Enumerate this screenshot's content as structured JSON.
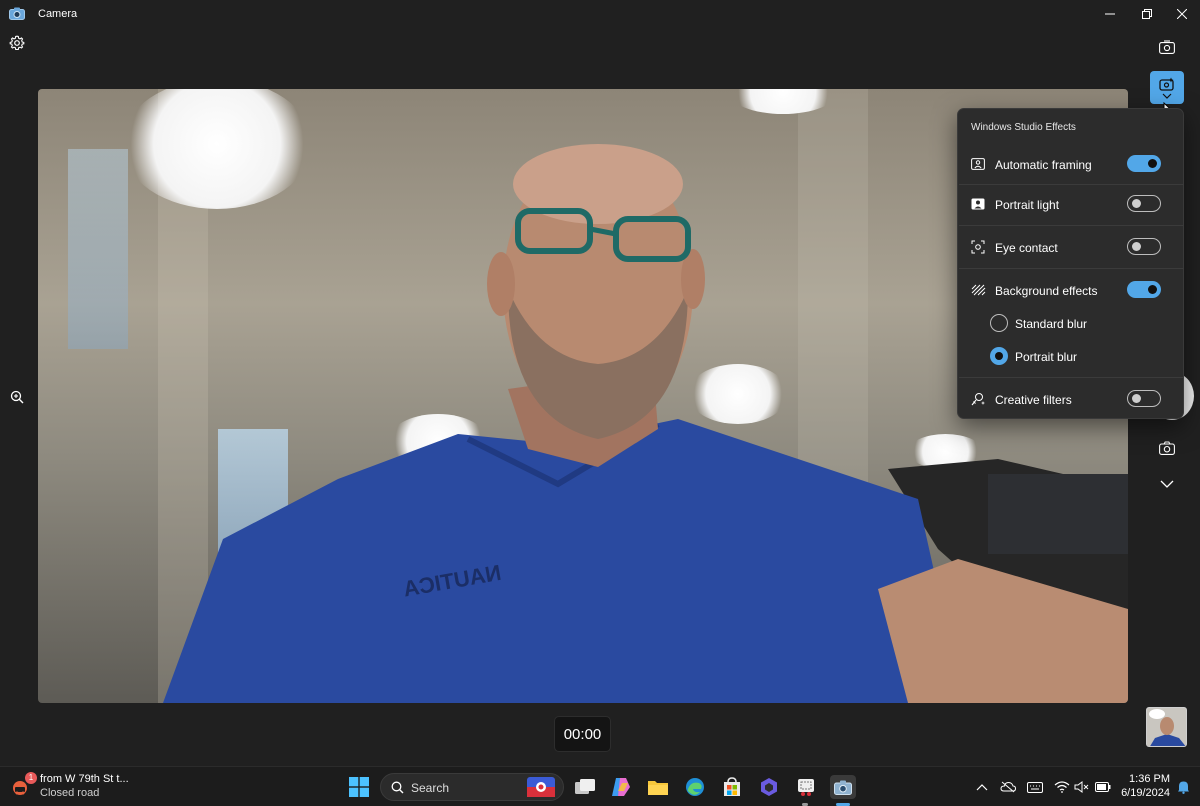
{
  "window": {
    "title": "Camera"
  },
  "timer": {
    "value": "00:00"
  },
  "studio_effects": {
    "title": "Windows Studio Effects",
    "items": [
      {
        "label": "Automatic framing",
        "icon": "framing-icon",
        "on": true
      },
      {
        "label": "Portrait light",
        "icon": "portrait-light-icon",
        "on": false
      },
      {
        "label": "Eye contact",
        "icon": "eye-contact-icon",
        "on": false
      },
      {
        "label": "Background effects",
        "icon": "background-effects-icon",
        "on": true
      },
      {
        "label": "Creative filters",
        "icon": "creative-filters-icon",
        "on": false
      }
    ],
    "background_options": [
      {
        "label": "Standard blur",
        "selected": false
      },
      {
        "label": "Portrait blur",
        "selected": true
      }
    ]
  },
  "taskbar": {
    "news": {
      "badge": "1",
      "line1": "from W 79th St t...",
      "line2": "Closed road"
    },
    "search_label": "Search",
    "clock": {
      "time": "1:36 PM",
      "date": "6/19/2024"
    }
  },
  "colors": {
    "accent": "#52a7e8",
    "background": "#202020",
    "flyout": "#2c2c2c"
  }
}
